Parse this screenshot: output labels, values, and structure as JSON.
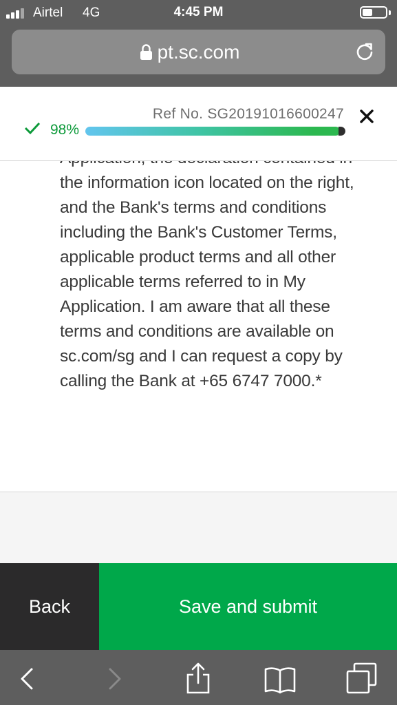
{
  "status_bar": {
    "carrier": "Airtel",
    "network": "4G",
    "time": "4:45 PM"
  },
  "browser": {
    "url": "pt.sc.com"
  },
  "progress": {
    "ref_no": "Ref No. SG20191016600247",
    "percent_label": "98%",
    "value": 0.98,
    "accent_color": "#0d9a3a"
  },
  "terms": {
    "text": "Application, the declaration contained in the information icon located on the right, and the Bank's terms and conditions including the Bank's Customer Terms, applicable product terms and all other applicable terms referred to in My Application. I am aware that all these terms and conditions are available on sc.com/sg and I can request a copy by calling the Bank at +65 6747 7000.*"
  },
  "actions": {
    "back_label": "Back",
    "submit_label": "Save and submit",
    "submit_color": "#00a84a",
    "back_color": "#2b2a2b"
  },
  "toolbar": {
    "icons": [
      "back-arrow-icon",
      "forward-arrow-icon",
      "share-icon",
      "bookmarks-icon",
      "tabs-icon"
    ]
  }
}
